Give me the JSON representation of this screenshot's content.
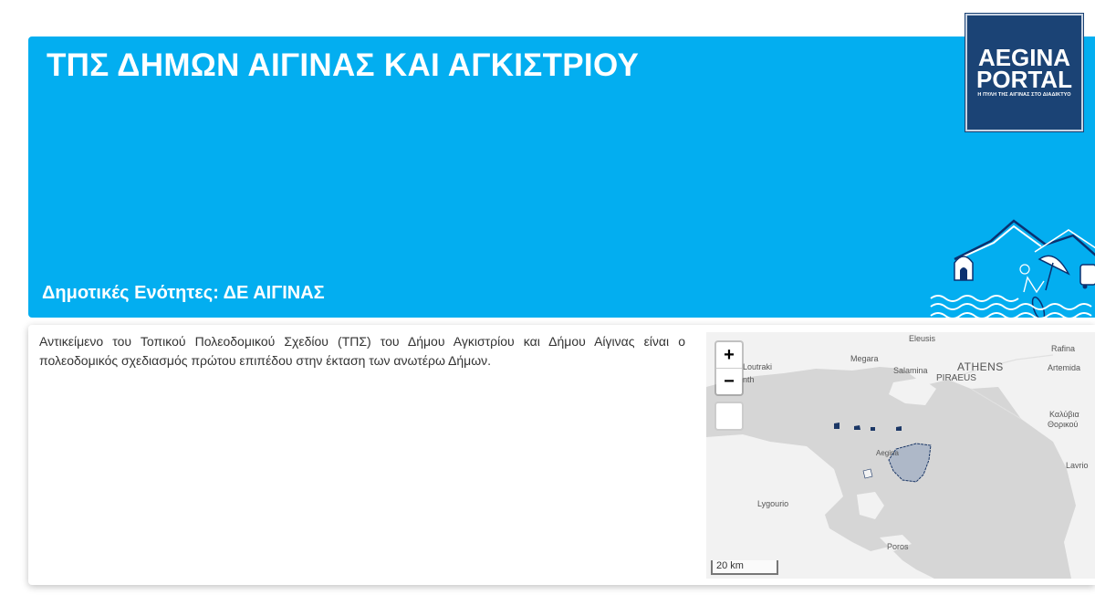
{
  "banner": {
    "title": "ΤΠΣ ΔΗΜΩΝ ΑΙΓΙΝΑΣ ΚΑΙ ΑΓΚΙΣΤΡΙΟΥ",
    "subtitle": "Δημοτικές Ενότητες: ΔΕ ΑΙΓΙΝΑΣ",
    "background_color": "#03aef0"
  },
  "logo": {
    "line1": "AEGINA",
    "line2": "PORTAL",
    "tagline": "Η ΠΥΛΗ ΤΗΣ ΑΙΓΙΝΑΣ ΣΤΟ ΔΙΑΔΙΚΤΥΟ",
    "background_color": "#1b4375"
  },
  "content": {
    "description": "Αντικείμενο του Τοπικού Πολεοδομικού Σχεδίου (ΤΠΣ) του Δήμου Αγκιστρίου και Δήμου Αίγινας είναι ο πολεοδομικός σχεδιασμός πρώτου επιπέδου στην έκταση των ανωτέρω Δήμων."
  },
  "map": {
    "zoom_in_label": "+",
    "zoom_out_label": "−",
    "scale_label": "20 km",
    "labels": {
      "eleusis": "Eleusis",
      "megara": "Megara",
      "salamina": "Salamina",
      "athens": "ATHENS",
      "piraeus": "PIRAEUS",
      "loutraki": "Loutraki",
      "corinth_partial": "nth",
      "rafina": "Rafina",
      "artemida": "Artemida",
      "kalyvia_latin": "Καλύβια",
      "thorikou": "Θορικού",
      "aegina": "Aegina",
      "lavrio": "Lavrio",
      "lygourio": "Lygourio",
      "poros": "Poros"
    },
    "colors": {
      "land": "#f2f2f2",
      "sea": "#d6d6d6",
      "highlight_border": "#1b3766",
      "highlight_fill": "#aeb8c8"
    }
  }
}
